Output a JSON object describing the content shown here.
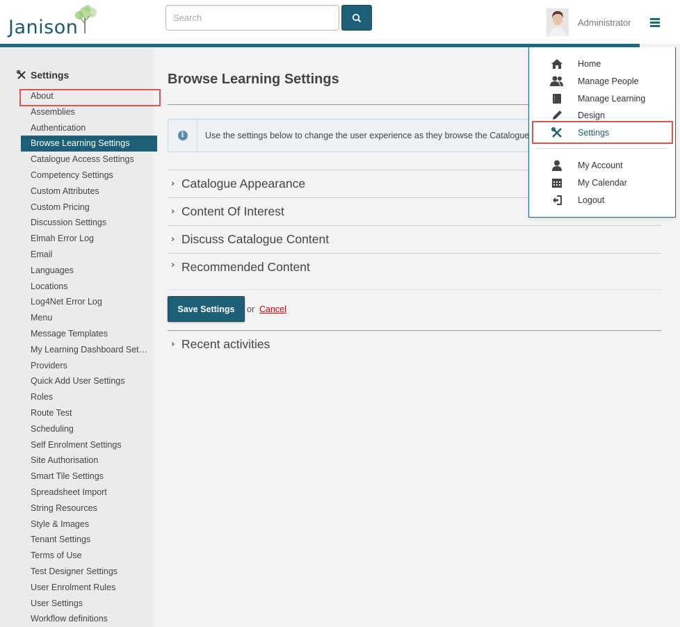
{
  "header": {
    "logo_text": "Janison",
    "search_placeholder": "Search",
    "user_name": "Administrator"
  },
  "sidebar": {
    "title": "Settings",
    "items": [
      {
        "label": "About"
      },
      {
        "label": "Assemblies"
      },
      {
        "label": "Authentication"
      },
      {
        "label": "Browse Learning Settings",
        "active": true
      },
      {
        "label": "Catalogue Access Settings"
      },
      {
        "label": "Competency Settings"
      },
      {
        "label": "Custom Attributes"
      },
      {
        "label": "Custom Pricing"
      },
      {
        "label": "Discussion Settings"
      },
      {
        "label": "Elmah Error Log"
      },
      {
        "label": "Email"
      },
      {
        "label": "Languages"
      },
      {
        "label": "Locations"
      },
      {
        "label": "Log4Net Error Log"
      },
      {
        "label": "Menu"
      },
      {
        "label": "Message Templates"
      },
      {
        "label": "My Learning Dashboard Settings"
      },
      {
        "label": "Providers"
      },
      {
        "label": "Quick Add User Settings"
      },
      {
        "label": "Roles"
      },
      {
        "label": "Route Test"
      },
      {
        "label": "Scheduling"
      },
      {
        "label": "Self Enrolment Settings"
      },
      {
        "label": "Site Authorisation"
      },
      {
        "label": "Smart Tile Settings"
      },
      {
        "label": "Spreadsheet Import"
      },
      {
        "label": "String Resources"
      },
      {
        "label": "Style & Images"
      },
      {
        "label": "Tenant Settings"
      },
      {
        "label": "Terms of Use"
      },
      {
        "label": "Test Designer Settings"
      },
      {
        "label": "User Enrolment Rules"
      },
      {
        "label": "User Settings"
      },
      {
        "label": "Workflow definitions"
      }
    ]
  },
  "main": {
    "title": "Browse Learning Settings",
    "info_text": "Use the settings below to change the user experience as they browse the Catalogue",
    "sections": [
      {
        "label": "Catalogue Appearance"
      },
      {
        "label": "Content Of Interest"
      },
      {
        "label": "Discuss Catalogue Content"
      },
      {
        "label": "Recommended Content"
      }
    ],
    "save_label": "Save Settings",
    "or_text": "or",
    "cancel_label": "Cancel",
    "recent_label": "Recent activities"
  },
  "menu": {
    "items": [
      {
        "label": "Home",
        "icon": "home-icon"
      },
      {
        "label": "Manage People",
        "icon": "people-icon"
      },
      {
        "label": "Manage Learning",
        "icon": "book-icon"
      },
      {
        "label": "Design",
        "icon": "pencil-icon"
      },
      {
        "label": "Settings",
        "icon": "wrench-icon",
        "active": true
      },
      {
        "label": "My Account",
        "icon": "user-icon"
      },
      {
        "label": "My Calendar",
        "icon": "calendar-icon"
      },
      {
        "label": "Logout",
        "icon": "logout-icon"
      }
    ]
  },
  "colors": {
    "brand": "#1d5f76",
    "highlight_outline": "#d9534f",
    "cancel_link": "#cc0000"
  }
}
